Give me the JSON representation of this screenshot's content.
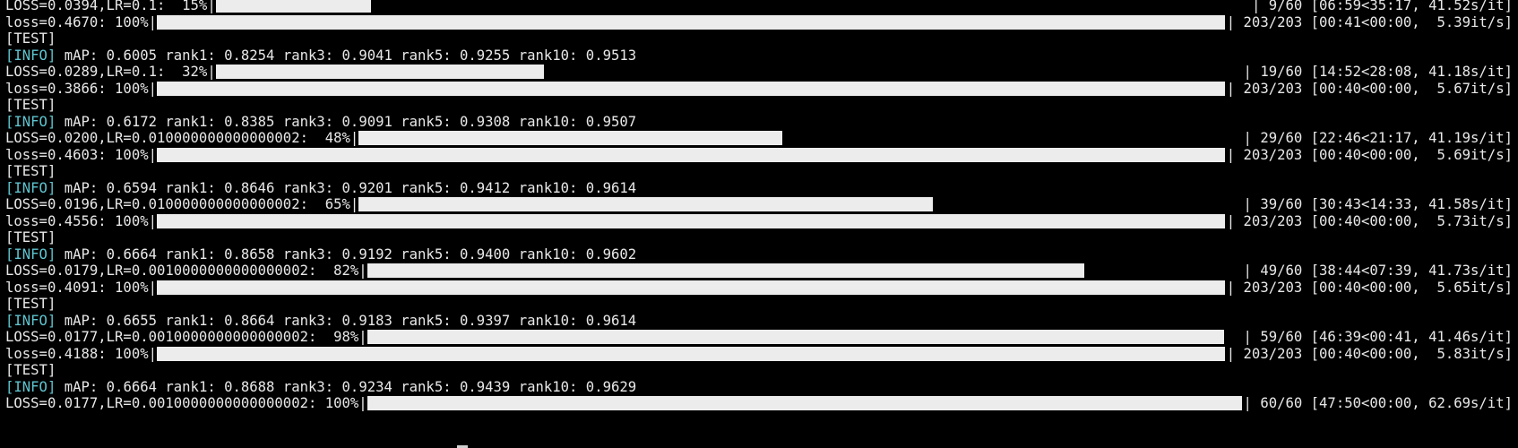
{
  "lines": [
    {
      "type": "progress",
      "prefix": "LOSS=0.0394,LR=0.1:  15%|",
      "fraction": 0.15,
      "suffix": "| 9/60 [06:59<35:17, 41.52s/it]"
    },
    {
      "type": "progress",
      "prefix": "loss=0.4670: 100%|",
      "fraction": 1.0,
      "suffix": "| 203/203 [00:41<00:00,  5.39it/s]"
    },
    {
      "type": "text",
      "text": "[TEST]"
    },
    {
      "type": "info",
      "tag": "[INFO]",
      "text": " mAP: 0.6005 rank1: 0.8254 rank3: 0.9041 rank5: 0.9255 rank10: 0.9513"
    },
    {
      "type": "progress",
      "prefix": "LOSS=0.0289,LR=0.1:  32%|",
      "fraction": 0.32,
      "suffix": "| 19/60 [14:52<28:08, 41.18s/it]"
    },
    {
      "type": "progress",
      "prefix": "loss=0.3866: 100%|",
      "fraction": 1.0,
      "suffix": "| 203/203 [00:40<00:00,  5.67it/s]"
    },
    {
      "type": "text",
      "text": "[TEST]"
    },
    {
      "type": "info",
      "tag": "[INFO]",
      "text": " mAP: 0.6172 rank1: 0.8385 rank3: 0.9091 rank5: 0.9308 rank10: 0.9507"
    },
    {
      "type": "progress",
      "prefix": "LOSS=0.0200,LR=0.010000000000000002:  48%|",
      "fraction": 0.48,
      "suffix": "| 29/60 [22:46<21:17, 41.19s/it]"
    },
    {
      "type": "progress",
      "prefix": "loss=0.4603: 100%|",
      "fraction": 1.0,
      "suffix": "| 203/203 [00:40<00:00,  5.69it/s]"
    },
    {
      "type": "text",
      "text": "[TEST]"
    },
    {
      "type": "info",
      "tag": "[INFO]",
      "text": " mAP: 0.6594 rank1: 0.8646 rank3: 0.9201 rank5: 0.9412 rank10: 0.9614"
    },
    {
      "type": "progress",
      "prefix": "LOSS=0.0196,LR=0.010000000000000002:  65%|",
      "fraction": 0.65,
      "suffix": "| 39/60 [30:43<14:33, 41.58s/it]"
    },
    {
      "type": "progress",
      "prefix": "loss=0.4556: 100%|",
      "fraction": 1.0,
      "suffix": "| 203/203 [00:40<00:00,  5.73it/s]"
    },
    {
      "type": "text",
      "text": "[TEST]"
    },
    {
      "type": "info",
      "tag": "[INFO]",
      "text": " mAP: 0.6664 rank1: 0.8658 rank3: 0.9192 rank5: 0.9400 rank10: 0.9602"
    },
    {
      "type": "progress",
      "prefix": "LOSS=0.0179,LR=0.0010000000000000002:  82%|",
      "fraction": 0.82,
      "suffix": "| 49/60 [38:44<07:39, 41.73s/it]"
    },
    {
      "type": "progress",
      "prefix": "loss=0.4091: 100%|",
      "fraction": 1.0,
      "suffix": "| 203/203 [00:40<00:00,  5.65it/s]"
    },
    {
      "type": "text",
      "text": "[TEST]"
    },
    {
      "type": "info",
      "tag": "[INFO]",
      "text": " mAP: 0.6655 rank1: 0.8664 rank3: 0.9183 rank5: 0.9397 rank10: 0.9614"
    },
    {
      "type": "progress",
      "prefix": "LOSS=0.0177,LR=0.0010000000000000002:  98%|",
      "fraction": 0.98,
      "suffix": "| 59/60 [46:39<00:41, 41.46s/it]"
    },
    {
      "type": "progress",
      "prefix": "loss=0.4188: 100%|",
      "fraction": 1.0,
      "suffix": "| 203/203 [00:40<00:00,  5.83it/s]"
    },
    {
      "type": "text",
      "text": "[TEST]"
    },
    {
      "type": "info",
      "tag": "[INFO]",
      "text": " mAP: 0.6664 rank1: 0.8688 rank3: 0.9234 rank5: 0.9439 rank10: 0.9629"
    },
    {
      "type": "progress",
      "prefix": "LOSS=0.0177,LR=0.0010000000000000002: 100%|",
      "fraction": 1.0,
      "suffix": "| 60/60 [47:50<00:00, 62.69s/it]"
    }
  ],
  "colors": {
    "background": "#000000",
    "text": "#e8e8e8",
    "info_tag": "#5ec4cf",
    "bar_fill": "#ececec"
  }
}
